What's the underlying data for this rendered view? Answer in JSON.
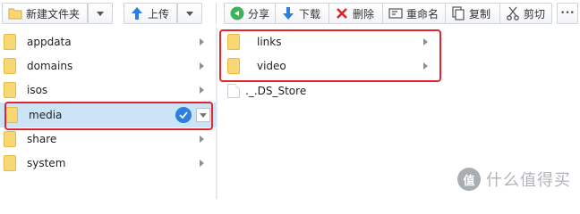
{
  "toolbar": {
    "new_folder_label": "新建文件夹",
    "upload_label": "上传",
    "share_label": "分享",
    "download_label": "下载",
    "delete_label": "删除",
    "rename_label": "重命名",
    "copy_label": "复制",
    "cut_label": "剪切",
    "more_label": "•••"
  },
  "left_pane": {
    "items": [
      {
        "label": "appdata"
      },
      {
        "label": "domains"
      },
      {
        "label": "isos"
      },
      {
        "label": "media",
        "selected": true
      },
      {
        "label": "share"
      },
      {
        "label": "system"
      }
    ]
  },
  "right_pane": {
    "items": [
      {
        "label": "links",
        "type": "folder"
      },
      {
        "label": "video",
        "type": "folder"
      },
      {
        "label": "._.DS_Store",
        "type": "file"
      }
    ]
  },
  "colors": {
    "selection": "#cce4f7",
    "highlight_box": "#e1262d",
    "folder": "#f8d775",
    "check_badge": "#2d7fe0"
  },
  "watermark": {
    "logo_text": "值",
    "text": "什么值得买"
  }
}
